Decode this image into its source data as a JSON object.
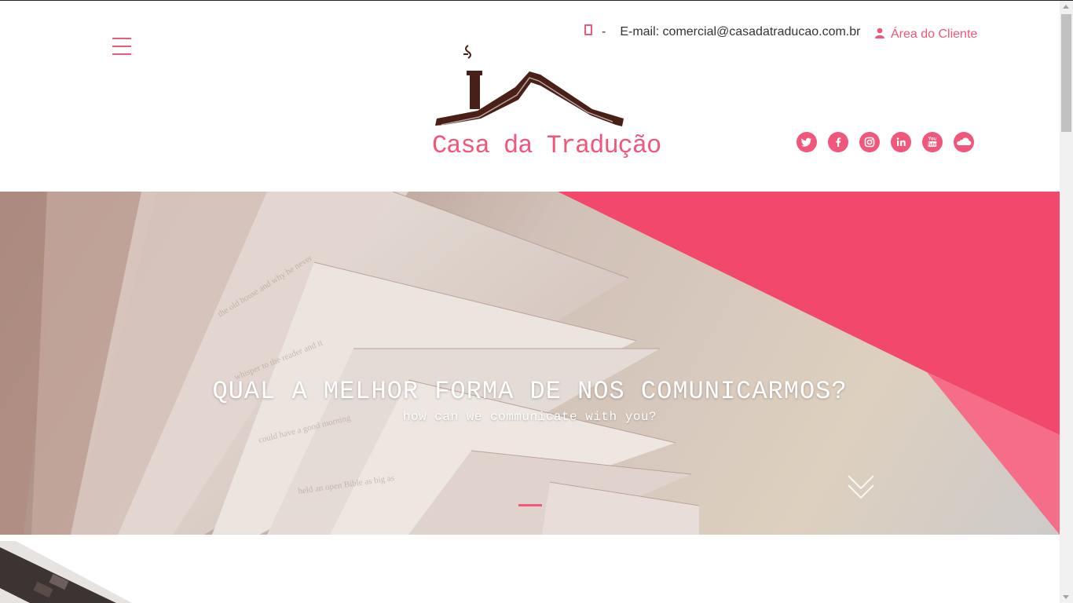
{
  "header": {
    "phone_separator": "-",
    "email_text": "E-mail: comercial@casadatraducao.com.br",
    "client_area_label": "Área do Cliente",
    "logo_text": "Casa da Tradução",
    "socials": [
      {
        "name": "twitter-icon",
        "glyph": "t"
      },
      {
        "name": "facebook-icon",
        "glyph": "f"
      },
      {
        "name": "instagram-icon",
        "glyph": ""
      },
      {
        "name": "linkedin-icon",
        "glyph": "in"
      },
      {
        "name": "youtube-icon",
        "glyph": ""
      },
      {
        "name": "soundcloud-icon",
        "glyph": ""
      }
    ]
  },
  "hero": {
    "title": "QUAL A MELHOR FORMA DE NOS COMUNICARMOS?",
    "subtitle": "how can we communicate with you?"
  },
  "colors": {
    "accent": "#f0577a",
    "logo_dark": "#4a1f17"
  }
}
